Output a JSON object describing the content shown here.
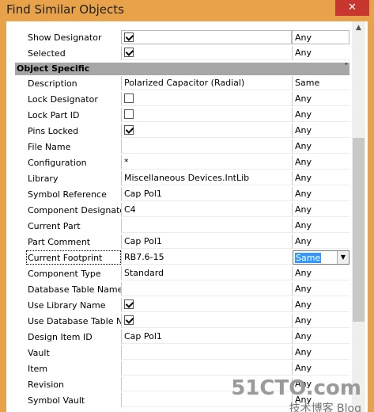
{
  "window": {
    "title": "Find Similar Objects",
    "close_glyph": "✕"
  },
  "rows_top": [
    {
      "label": "Show Designator",
      "type": "check",
      "checked": true,
      "match": "Any"
    },
    {
      "label": "Selected",
      "type": "check",
      "checked": true,
      "match": "Any"
    }
  ],
  "section": {
    "title": "Object Specific",
    "chevron": "ˇ"
  },
  "rows": [
    {
      "label": "Description",
      "type": "text",
      "value": "Polarized Capacitor (Radial)",
      "match": "Same"
    },
    {
      "label": "Lock Designator",
      "type": "check",
      "checked": false,
      "match": "Any"
    },
    {
      "label": "Lock Part ID",
      "type": "check",
      "checked": false,
      "match": "Any"
    },
    {
      "label": "Pins Locked",
      "type": "check",
      "checked": true,
      "match": "Any"
    },
    {
      "label": "File Name",
      "type": "text",
      "value": "",
      "match": "Any"
    },
    {
      "label": "Configuration",
      "type": "text",
      "value": "*",
      "match": "Any"
    },
    {
      "label": "Library",
      "type": "text",
      "value": "Miscellaneous Devices.IntLib",
      "match": "Any"
    },
    {
      "label": "Symbol Reference",
      "type": "text",
      "value": "Cap Pol1",
      "match": "Any"
    },
    {
      "label": "Component Designator",
      "type": "text",
      "value": "C4",
      "match": "Any"
    },
    {
      "label": "Current Part",
      "type": "text",
      "value": "",
      "match": "Any"
    },
    {
      "label": "Part Comment",
      "type": "text",
      "value": "Cap Pol1",
      "match": "Any"
    },
    {
      "label": "Current Footprint",
      "type": "text",
      "value": "RB7.6-15",
      "match": "Same",
      "focused": true
    },
    {
      "label": "Component Type",
      "type": "text",
      "value": "Standard",
      "match": "Any"
    },
    {
      "label": "Database Table Name",
      "type": "text",
      "value": "",
      "match": "Any"
    },
    {
      "label": "Use Library Name",
      "type": "check",
      "checked": true,
      "match": "Any"
    },
    {
      "label": "Use Database Table Name",
      "type": "check",
      "checked": true,
      "match": "Any"
    },
    {
      "label": "Design Item ID",
      "type": "text",
      "value": "Cap Pol1",
      "match": "Any"
    },
    {
      "label": "Vault",
      "type": "text",
      "value": "",
      "match": "Any"
    },
    {
      "label": "Item",
      "type": "text",
      "value": "",
      "match": "Any"
    },
    {
      "label": "Revision",
      "type": "text",
      "value": "",
      "match": "Any"
    },
    {
      "label": "Symbol Vault",
      "type": "text",
      "value": "",
      "match": "Any"
    }
  ],
  "dropdown_glyph": "▼",
  "scroll_up_glyph": "▲",
  "scroll_down_glyph": "▼",
  "watermark": {
    "line1": "51CTO.com",
    "line2": "技术博客 Blog"
  }
}
